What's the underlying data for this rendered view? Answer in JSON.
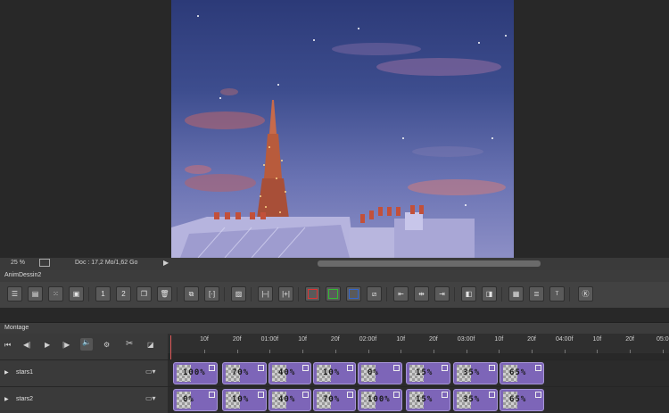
{
  "status": {
    "zoom": "25 %",
    "doc_info": "Doc : 17,2 Mo/1,62 Go"
  },
  "panel": {
    "title": "AnimDessin2"
  },
  "timeline": {
    "title": "Montage",
    "ruler_labels": [
      "10f",
      "20f",
      "01:00f",
      "10f",
      "20f",
      "02:00f",
      "10f",
      "20f",
      "03:00f",
      "10f",
      "20f",
      "04:00f",
      "10f",
      "20f",
      "05:0"
    ],
    "layers": [
      {
        "name": "stars1",
        "clips": [
          "100%",
          "70%",
          "40%",
          "10%",
          "0%",
          "15%",
          "35%",
          "65%"
        ]
      },
      {
        "name": "stars2",
        "clips": [
          "0%",
          "10%",
          "40%",
          "70%",
          "100%",
          "15%",
          "35%",
          "65%"
        ]
      }
    ]
  },
  "colors": {
    "clip": "#7d65b8",
    "accent_red": "#d33",
    "accent_green": "#3b3",
    "accent_blue": "#36c"
  },
  "icons": [
    "layers-icon",
    "frames-icon",
    "grid-icon",
    "save-icon",
    "layer1-icon",
    "layer2-icon",
    "copy-icon",
    "trash-icon",
    "duplicate-icon",
    "fit-icon",
    "hatch-icon",
    "span-icon",
    "span-plus-icon",
    "red-square-icon",
    "green-square-icon",
    "blue-square-icon",
    "slash-icon",
    "frames-left-icon",
    "frames-mid-icon",
    "frames-right-icon",
    "panel-left-icon",
    "panel-right-icon",
    "doc-icon",
    "doc-lines-icon",
    "text-icon",
    "settings-badge-icon"
  ]
}
